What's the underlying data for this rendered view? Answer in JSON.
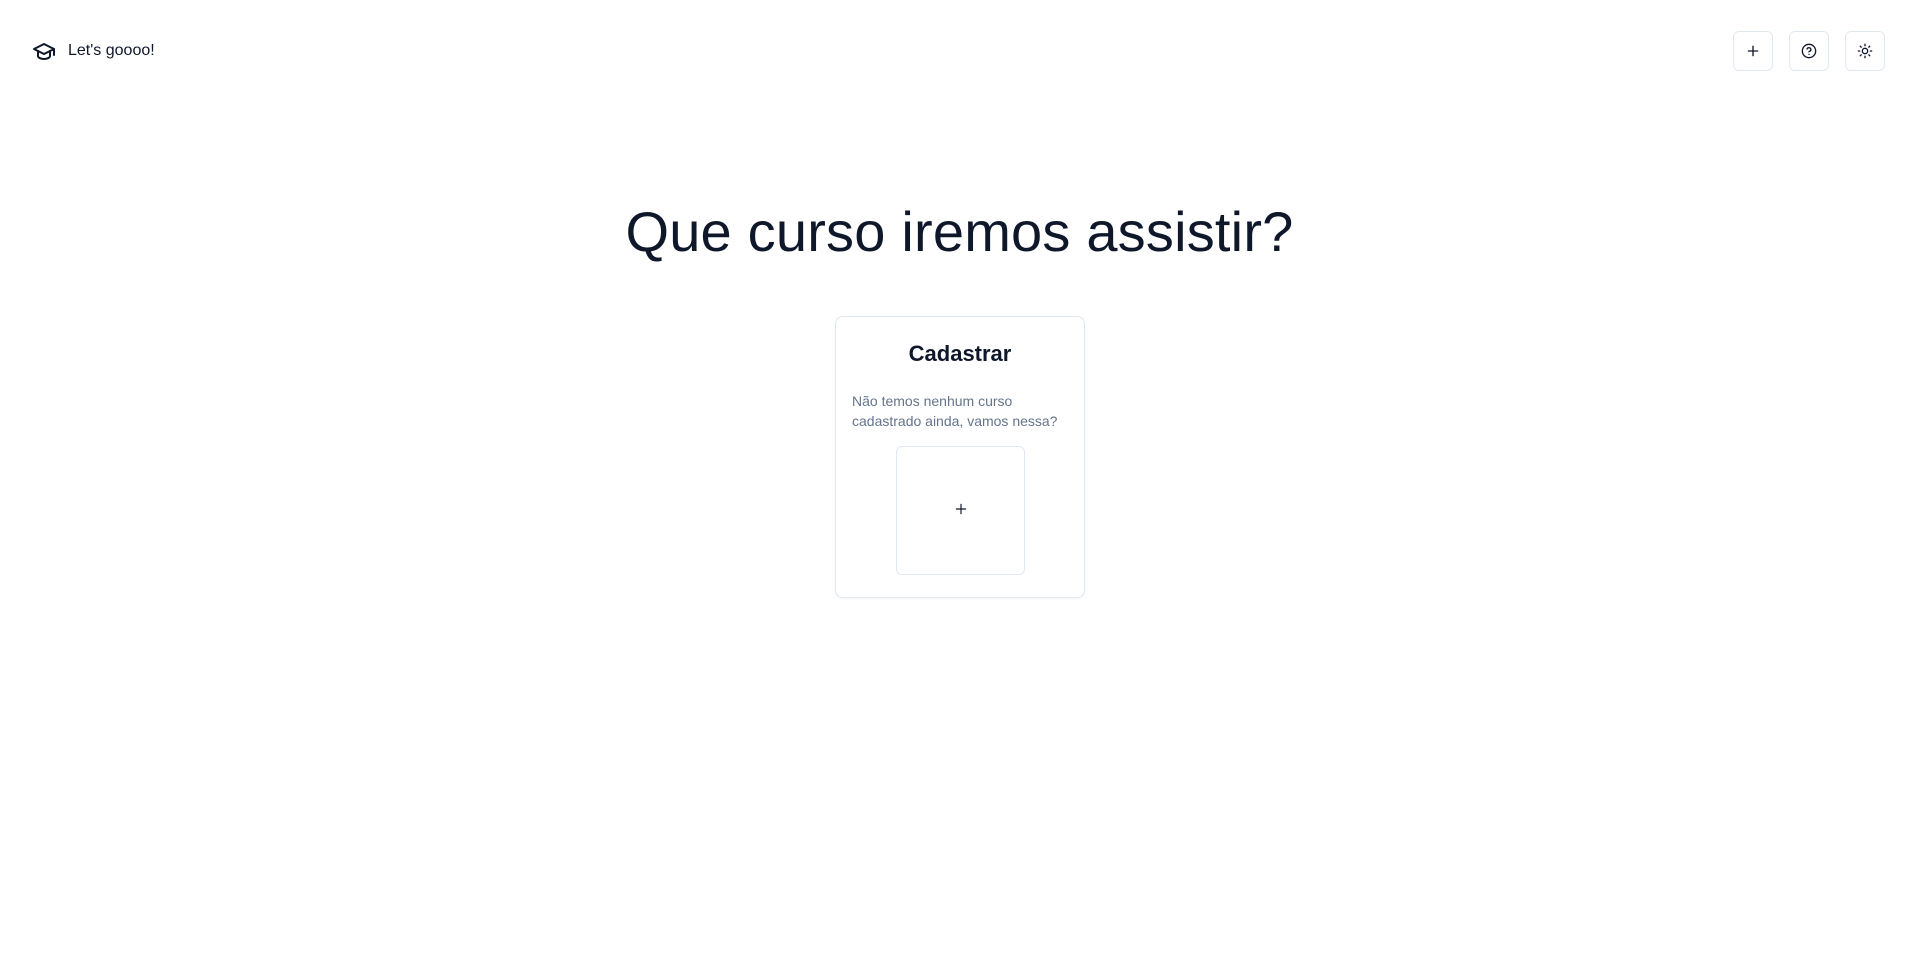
{
  "header": {
    "brand_icon": "graduation-cap-icon",
    "brand_text": "Let's goooo!",
    "actions": [
      {
        "name": "add-course-button",
        "icon": "plus-icon"
      },
      {
        "name": "help-button",
        "icon": "help-circle-icon"
      },
      {
        "name": "theme-toggle-button",
        "icon": "sun-icon"
      }
    ]
  },
  "hero": {
    "title": "Que curso iremos assistir?"
  },
  "card": {
    "title": "Cadastrar",
    "description": "Não temos nenhum curso cadastrado ainda, vamos nessa?",
    "add_icon": "plus-icon"
  },
  "colors": {
    "text": "#0f172a",
    "muted": "#64748b",
    "border": "#e2e8f0",
    "background": "#ffffff"
  }
}
